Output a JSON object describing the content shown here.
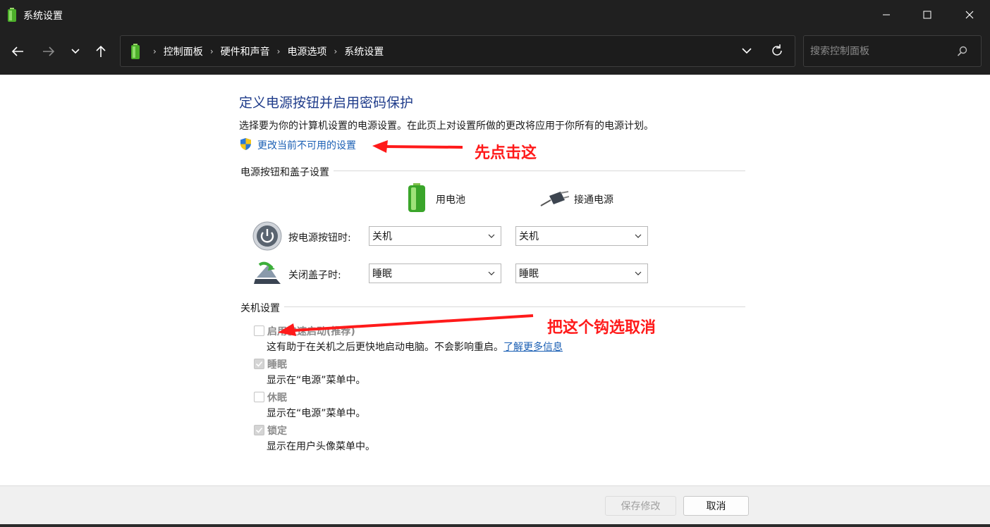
{
  "window": {
    "title": "系统设置",
    "controls": [
      "minimize-icon",
      "maximize-icon",
      "close-icon"
    ]
  },
  "nav": {
    "breadcrumbs": [
      "控制面板",
      "硬件和声音",
      "电源选项",
      "系统设置"
    ],
    "search_placeholder": "搜索控制面板"
  },
  "page": {
    "heading": "定义电源按钮并启用密码保护",
    "description": "选择要为你的计算机设置的电源设置。在此页上对设置所做的更改将应用于你所有的电源计划。",
    "change_link": "更改当前不可用的设置"
  },
  "power_buttons": {
    "section_title": "电源按钮和盖子设置",
    "col_battery": "用电池",
    "col_plugged": "接通电源",
    "rows": [
      {
        "label": "按电源按钮时:",
        "battery": "关机",
        "plugged": "关机"
      },
      {
        "label": "关闭盖子时:",
        "battery": "睡眠",
        "plugged": "睡眠"
      }
    ]
  },
  "shutdown": {
    "section_title": "关机设置",
    "items": [
      {
        "label": "启用快速启动(推荐)",
        "desc": "这有助于在关机之后更快地启动电脑。不会影响重启。",
        "link": "了解更多信息",
        "checked": false
      },
      {
        "label": "睡眠",
        "desc": "显示在“电源”菜单中。",
        "checked": true
      },
      {
        "label": "休眠",
        "desc": "显示在“电源”菜单中。",
        "checked": false
      },
      {
        "label": "锁定",
        "desc": "显示在用户头像菜单中。",
        "checked": true
      }
    ]
  },
  "annotations": {
    "first": "先点击这",
    "second": "把这个钩选取消"
  },
  "footer": {
    "save": "保存修改",
    "cancel": "取消"
  },
  "colors": {
    "heading": "#1e3b8a",
    "link": "#1a5fb4",
    "annotation": "#ff1a1a",
    "titlebar": "#202020"
  }
}
